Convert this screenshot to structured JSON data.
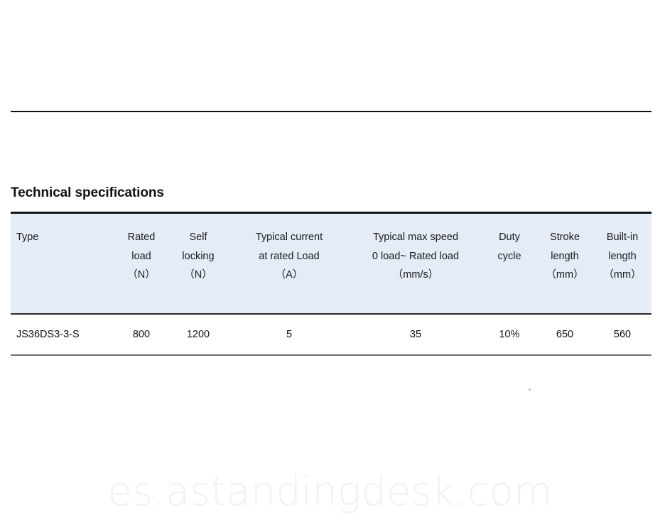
{
  "document": {
    "section_title": "Technical specifications",
    "watermark": "es.astandingdesk.com"
  },
  "table": {
    "columns": [
      {
        "id": "type",
        "lines": [
          "Type",
          "",
          ""
        ]
      },
      {
        "id": "rated_load",
        "lines": [
          "Rated",
          "load",
          "（N）"
        ]
      },
      {
        "id": "self_locking",
        "lines": [
          "Self",
          "locking",
          "（N）"
        ]
      },
      {
        "id": "typical_current",
        "lines": [
          "Typical current",
          "at rated Load",
          "（A）"
        ]
      },
      {
        "id": "typical_max_speed",
        "lines": [
          "Typical max speed",
          "0 load~ Rated load",
          "（mm/s）"
        ]
      },
      {
        "id": "duty_cycle",
        "lines": [
          "Duty",
          "cycle",
          ""
        ]
      },
      {
        "id": "stroke_length",
        "lines": [
          "Stroke",
          "length",
          "（mm）"
        ]
      },
      {
        "id": "builtin_length",
        "lines": [
          "Built-in",
          "length",
          "（mm）"
        ]
      }
    ],
    "rows": [
      {
        "type": "JS36DS3-3-S",
        "rated_load": "800",
        "self_locking": "1200",
        "typical_current": "5",
        "typical_max_speed": "35",
        "duty_cycle": "10%",
        "stroke_length": "650",
        "builtin_length": "560"
      }
    ]
  },
  "chart_data": {
    "type": "table",
    "title": "Technical specifications",
    "categories": [
      "Type",
      "Rated load (N)",
      "Self locking (N)",
      "Typical current at rated Load (A)",
      "Typical max speed 0 load~ Rated load (mm/s)",
      "Duty cycle",
      "Stroke length (mm)",
      "Built-in length (mm)"
    ],
    "series": [
      {
        "name": "JS36DS3-3-S",
        "values": [
          "JS36DS3-3-S",
          800,
          1200,
          5,
          35,
          "10%",
          650,
          560
        ]
      }
    ]
  }
}
